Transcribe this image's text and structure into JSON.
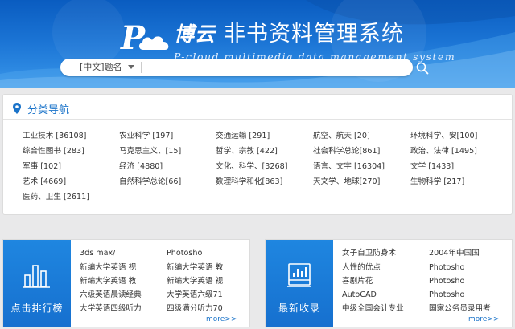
{
  "banner": {
    "logo_letter": "P",
    "title_prefix": "博云",
    "title_cn": "非书资料管理系统",
    "subtitle_en": "P-cloud  multimedia data management system"
  },
  "search": {
    "scope_selected": "[中文]题名",
    "placeholder": ""
  },
  "categories": {
    "title": "分类导航",
    "items": [
      {
        "label": "工业技术 [36108]"
      },
      {
        "label": "农业科学 [197]"
      },
      {
        "label": "交通运输 [291]"
      },
      {
        "label": "航空、航天 [20]"
      },
      {
        "label": "环境科学、安[100]"
      },
      {
        "label": "综合性图书 [283]"
      },
      {
        "label": "马克思主义、[15]"
      },
      {
        "label": "哲学、宗教 [422]"
      },
      {
        "label": "社会科学总论[861]"
      },
      {
        "label": "政治、法律 [1495]"
      },
      {
        "label": "军事 [102]"
      },
      {
        "label": "经济 [4880]"
      },
      {
        "label": "文化、科学、[3268]"
      },
      {
        "label": "语言、文字 [16304]"
      },
      {
        "label": "文学 [1433]"
      },
      {
        "label": "艺术 [4669]"
      },
      {
        "label": "自然科学总论[66]"
      },
      {
        "label": "数理科学和化[863]"
      },
      {
        "label": "天文学、地球[270]"
      },
      {
        "label": "生物科学 [217]"
      },
      {
        "label": "医药、卫生 [2611]"
      }
    ]
  },
  "ranking": {
    "title": "点击排行榜",
    "more": "more>>",
    "col1": [
      "3ds max/",
      "新编大学英语 视",
      "新编大学英语 教",
      "六级英语晨读经典",
      "大学英语四级听力"
    ],
    "col2": [
      "Photosho",
      "新编大学英语 教",
      "新编大学英语 视",
      "大学英语六级71",
      "四级满分听力70"
    ]
  },
  "latest": {
    "title": "最新收录",
    "more": "more>>",
    "col1": [
      "女子自卫防身术",
      "人性的优点",
      "喜剧片花",
      "AutoCAD",
      "中级全国会计专业"
    ],
    "col2": [
      "2004年中国国",
      "Photosho",
      "Photosho",
      "Photosho",
      "国家公务员录用考"
    ]
  },
  "colors": {
    "accent": "#1a73c9",
    "banner_blue": "#1670cf",
    "page_bg": "#e9e9ea"
  }
}
